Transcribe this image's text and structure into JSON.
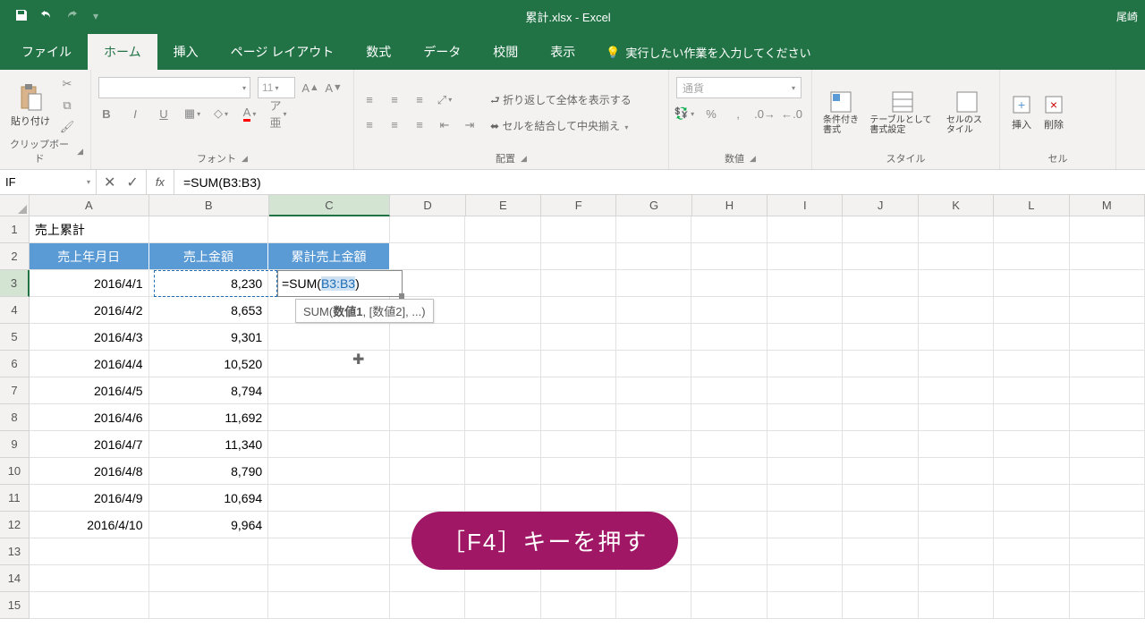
{
  "title_bar": {
    "document_title": "累計.xlsx - Excel",
    "user": "尾崎"
  },
  "ribbon_tabs": {
    "file": "ファイル",
    "home": "ホーム",
    "insert": "挿入",
    "page_layout": "ページ レイアウト",
    "formulas": "数式",
    "data": "データ",
    "review": "校閲",
    "view": "表示",
    "tell_me": "実行したい作業を入力してください"
  },
  "ribbon": {
    "clipboard": {
      "label": "クリップボード",
      "paste": "貼り付け"
    },
    "font": {
      "label": "フォント",
      "size": "11"
    },
    "alignment": {
      "label": "配置",
      "wrap": "折り返して全体を表示する",
      "merge": "セルを結合して中央揃え"
    },
    "number": {
      "label": "数値",
      "format": "通貨"
    },
    "styles": {
      "label": "スタイル",
      "cond": "条件付き書式",
      "table": "テーブルとして書式設定",
      "cell": "セルのスタイル"
    },
    "cells": {
      "label": "セル",
      "insert": "挿入",
      "delete": "削除"
    }
  },
  "formula_bar": {
    "name_box": "IF",
    "formula": "=SUM(B3:B3)"
  },
  "columns": [
    "A",
    "B",
    "C",
    "D",
    "E",
    "F",
    "G",
    "H",
    "I",
    "J",
    "K",
    "L",
    "M"
  ],
  "sheet": {
    "a1": "売上累計",
    "headers": {
      "a": "売上年月日",
      "b": "売上金額",
      "c": "累計売上金額"
    },
    "rows": [
      {
        "date": "2016/4/1",
        "amount": "8,230"
      },
      {
        "date": "2016/4/2",
        "amount": "8,653"
      },
      {
        "date": "2016/4/3",
        "amount": "9,301"
      },
      {
        "date": "2016/4/4",
        "amount": "10,520"
      },
      {
        "date": "2016/4/5",
        "amount": "8,794"
      },
      {
        "date": "2016/4/6",
        "amount": "11,692"
      },
      {
        "date": "2016/4/7",
        "amount": "11,340"
      },
      {
        "date": "2016/4/8",
        "amount": "8,790"
      },
      {
        "date": "2016/4/9",
        "amount": "10,694"
      },
      {
        "date": "2016/4/10",
        "amount": "9,964"
      }
    ]
  },
  "editing": {
    "prefix": "=SUM(",
    "arg": "B3:B3",
    "suffix": ")"
  },
  "tooltip": {
    "fn": "SUM(",
    "bold": "数値1",
    "rest": ", [数値2], ...)"
  },
  "callout": "［F4］キーを押す",
  "chart_data": {
    "type": "table",
    "title": "売上累計",
    "columns": [
      "売上年月日",
      "売上金額",
      "累計売上金額"
    ],
    "rows": [
      [
        "2016/4/1",
        8230,
        null
      ],
      [
        "2016/4/2",
        8653,
        null
      ],
      [
        "2016/4/3",
        9301,
        null
      ],
      [
        "2016/4/4",
        10520,
        null
      ],
      [
        "2016/4/5",
        8794,
        null
      ],
      [
        "2016/4/6",
        11692,
        null
      ],
      [
        "2016/4/7",
        11340,
        null
      ],
      [
        "2016/4/8",
        8790,
        null
      ],
      [
        "2016/4/9",
        10694,
        null
      ],
      [
        "2016/4/10",
        9964,
        null
      ]
    ]
  }
}
